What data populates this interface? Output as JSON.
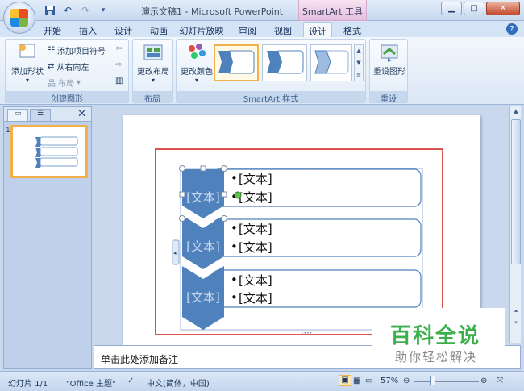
{
  "window": {
    "title": "演示文稿1 - Microsoft PowerPoint",
    "contextual_tab_group": "SmartArt 工具",
    "controls": [
      "minimize-icon",
      "maximize-icon",
      "close-icon"
    ]
  },
  "quick_access": [
    "save-icon",
    "undo-icon",
    "redo-icon",
    "customize-icon"
  ],
  "tabs": [
    "开始",
    "插入",
    "设计",
    "动画",
    "幻灯片放映",
    "审阅",
    "视图",
    "设计",
    "格式"
  ],
  "active_tab_index": 7,
  "ribbon": {
    "create_graphic": {
      "label": "创建图形",
      "add_shape": "添加形状",
      "add_bullet": "添加项目符号",
      "right_to_left": "从右向左",
      "layout": "布局"
    },
    "layouts": {
      "label": "布局",
      "change_layout": "更改布局"
    },
    "styles": {
      "label": "SmartArt 样式",
      "change_colors": "更改颜色"
    },
    "reset": {
      "label": "重设",
      "reset_graphic": "重设图形"
    }
  },
  "slides_pane": {
    "slide_number": "1"
  },
  "smartart": {
    "items": [
      {
        "chevron": "[文本]",
        "bullets": [
          "[文本]",
          "[文本]"
        ]
      },
      {
        "chevron": "[文本]",
        "bullets": [
          "[文本]",
          "[文本]"
        ]
      },
      {
        "chevron": "[文本]",
        "bullets": [
          "[文本]",
          "[文本]"
        ]
      }
    ],
    "accent_color": "#4f81bd",
    "frame_color": "#d9534f"
  },
  "notes": {
    "placeholder": "单击此处添加备注"
  },
  "status": {
    "slide": "幻灯片 1/1",
    "theme": "\"Office 主题\"",
    "language": "中文(简体，中国)",
    "zoom": "57%"
  },
  "watermark": {
    "title": "百科全说",
    "subtitle": "助你轻松解决"
  }
}
